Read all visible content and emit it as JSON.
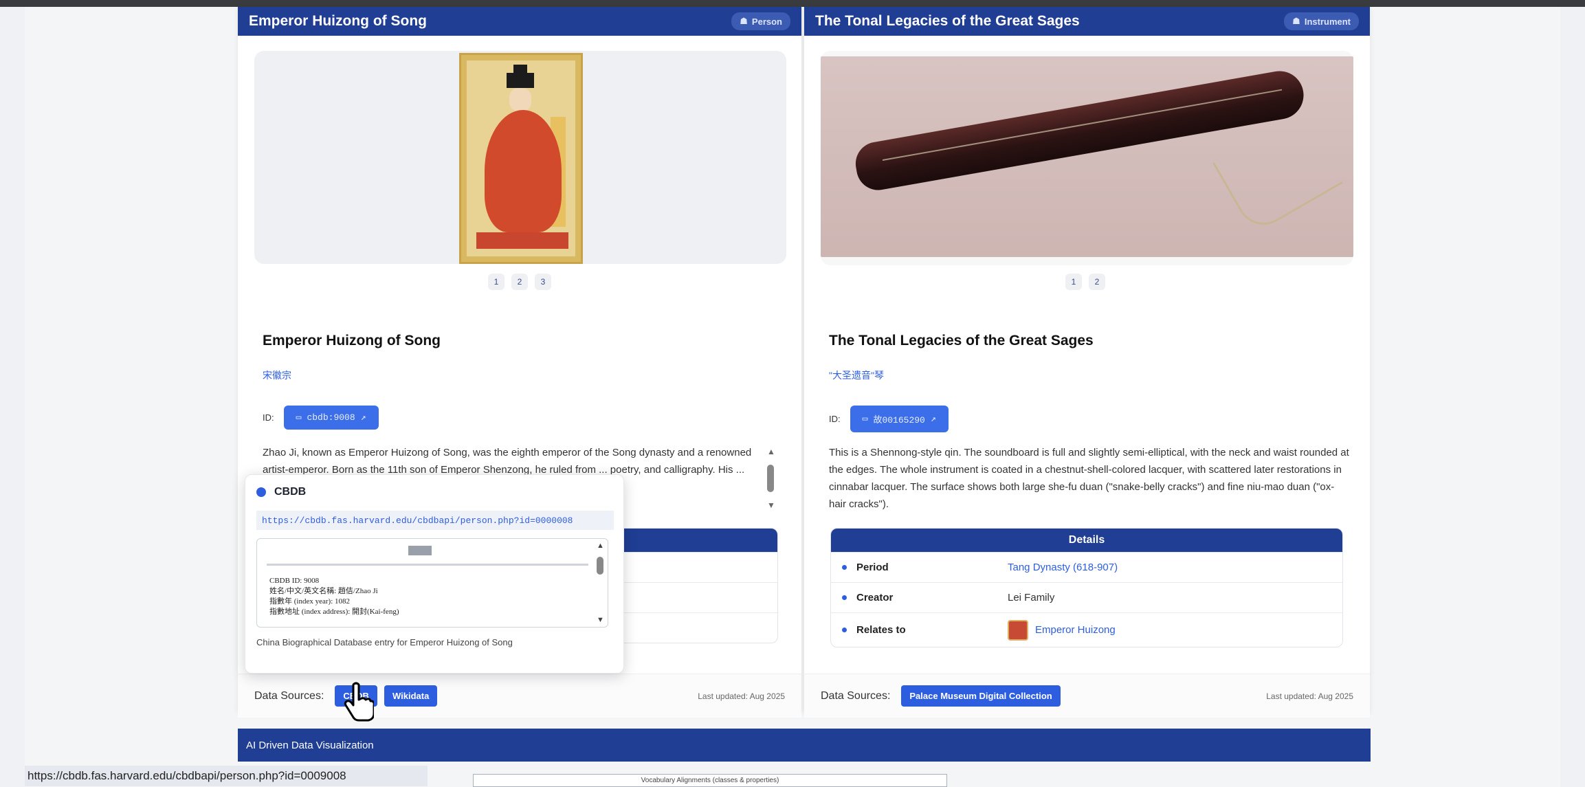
{
  "cards": {
    "left": {
      "header_title": "Emperor Huizong of Song",
      "badge": "Person",
      "pager": [
        "1",
        "2",
        "3"
      ],
      "title": "Emperor Huizong of Song",
      "subtitle": "宋徽宗",
      "id_label": "ID:",
      "id_value": "cbdb:9008",
      "description": "Zhao Ji, known as Emperor Huizong of Song, was the eighth emperor of the Song dynasty and a renowned artist-emperor. Born as the 11th son of Emperor Shenzong, he ruled from ... poetry, and calligraphy. His ... ultimately led to the fall of",
      "footer_label": "Data Sources:",
      "sources": [
        "CBDB",
        "Wikidata"
      ],
      "updated": "Last updated: Aug 2025"
    },
    "right": {
      "header_title": "The Tonal Legacies of the Great Sages",
      "badge": "Instrument",
      "pager": [
        "1",
        "2"
      ],
      "title": "The Tonal Legacies of the Great Sages",
      "subtitle": "\"大圣遗音\"琴",
      "id_label": "ID:",
      "id_value": "故00165290",
      "description": "This is a Shennong-style qin. The soundboard is full and slightly semi-elliptical, with the neck and waist rounded at the edges. The whole instrument is coated in a chestnut-shell-colored lacquer, with scattered later restorations in cinnabar lacquer. The surface shows both large she-fu duan (\"snake-belly cracks\") and fine niu-mao duan (\"ox-hair cracks\").",
      "details_title": "Details",
      "details": [
        {
          "key": "Period",
          "value": "Tang Dynasty (618-907)"
        },
        {
          "key": "Creator",
          "value": "Lei Family"
        },
        {
          "key": "Relates to",
          "value": "Emperor Huizong"
        }
      ],
      "footer_label": "Data Sources:",
      "sources": [
        "Palace Museum Digital Collection"
      ],
      "updated": "Last updated: Aug 2025"
    }
  },
  "popover": {
    "title": "CBDB",
    "url": "https://cbdb.fas.harvard.edu/cbdbapi/person.php?id=0000008",
    "frame_lines": [
      "CBDB ID: 9008",
      "姓名/中文/英文名稱: 趙佶/Zhao Ji",
      "指數年 (index year): 1082",
      "指數地址 (index address): 開封(Kai-feng)"
    ],
    "caption": "China Biographical Database entry for Emperor Huizong of Song"
  },
  "viz_bar_title": "AI Driven Data Visualization",
  "viz_preview_title": "Vocabulary Alignments (classes & properties)",
  "status_url": "https://cbdb.fas.harvard.edu/cbdbapi/person.php?id=0009008",
  "colors": {
    "header": "#1f3e94",
    "accent": "#2d5ee0"
  }
}
